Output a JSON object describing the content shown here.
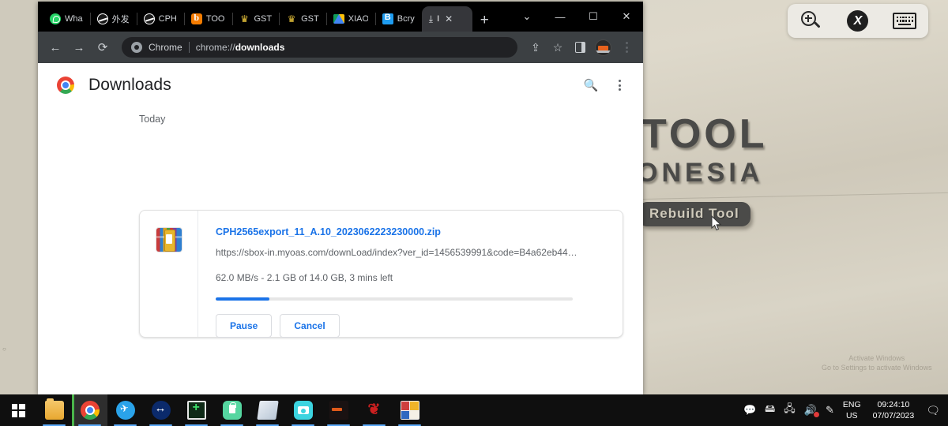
{
  "remote_toolbar": {
    "buttons": [
      {
        "name": "zoom-in",
        "icon": "magnifier-plus-icon"
      },
      {
        "name": "rustdesk",
        "icon": "rustdesk-logo-icon",
        "glyph": "X"
      },
      {
        "name": "keyboard",
        "icon": "keyboard-icon"
      }
    ]
  },
  "wallpaper": {
    "sign_line1": "TOOL",
    "sign_line2": "ONESIA",
    "sign_line3": "Rebuild Tool",
    "watermark": "Activate Windows\nGo to Settings to activate Windows"
  },
  "browser": {
    "tabs": [
      {
        "label": "Wha",
        "favicon": "whatsapp-icon",
        "active": false
      },
      {
        "label": "外发",
        "favicon": "globe-icon",
        "active": false
      },
      {
        "label": "CPH",
        "favicon": "globe-icon",
        "active": false
      },
      {
        "label": "TOO",
        "favicon": "blogger-icon",
        "active": false
      },
      {
        "label": "GST",
        "favicon": "trophy-icon",
        "active": false
      },
      {
        "label": "GST",
        "favicon": "trophy-icon",
        "active": false
      },
      {
        "label": "XIAO",
        "favicon": "google-drive-icon",
        "active": false
      },
      {
        "label": "Bcry",
        "favicon": "blue-b-icon",
        "active": false
      },
      {
        "label": "I",
        "favicon": "download-icon",
        "active": true
      }
    ],
    "new_tab_label": "+",
    "window_controls": {
      "tab_search": "⌄",
      "minimize": "—",
      "maximize": "☐",
      "close": "✕"
    },
    "toolbar": {
      "back": "←",
      "forward": "→",
      "reload": "⟳",
      "omnibox_scheme_label": "Chrome",
      "omnibox_url_prefix": "chrome://",
      "omnibox_url_bold": "downloads",
      "share_icon": "share-icon",
      "bookmark_icon": "star-icon",
      "sidepanel_icon": "side-panel-icon",
      "profile_icon": "profile-avatar",
      "menu_icon": "kebab-menu-icon"
    }
  },
  "downloads_page": {
    "title": "Downloads",
    "search_icon": "search-icon",
    "menu_icon": "kebab-menu-icon",
    "section_label": "Today",
    "item": {
      "file_icon": "winrar-archive-icon",
      "filename": "CPH2565export_11_A.10_2023062223230000.zip",
      "url": "https://sbox-in.myoas.com/downLoad/index?ver_id=1456539991&code=B4a62eb44…",
      "status": "62.0 MB/s - 2.1 GB of 14.0 GB, 3 mins left",
      "progress_percent": 15,
      "pause_label": "Pause",
      "cancel_label": "Cancel",
      "accent_color": "#1a73e8"
    }
  },
  "taskbar": {
    "start": "windows-start-icon",
    "apps": [
      {
        "name": "file-explorer",
        "icon": "folder-icon"
      },
      {
        "name": "google-chrome",
        "icon": "chrome-icon",
        "active": true
      },
      {
        "name": "telegram",
        "icon": "telegram-icon"
      },
      {
        "name": "teamviewer",
        "icon": "teamviewer-icon"
      },
      {
        "name": "green-app",
        "icon": "green-frame-icon"
      },
      {
        "name": "vpn",
        "icon": "lock-icon"
      },
      {
        "name": "notes",
        "icon": "notes-icon"
      },
      {
        "name": "camera",
        "icon": "camera-icon"
      },
      {
        "name": "dark-app",
        "icon": "dark-bar-icon"
      },
      {
        "name": "red-logo-app",
        "icon": "red-logo-icon"
      },
      {
        "name": "color-blocks-app",
        "icon": "color-blocks-icon"
      }
    ],
    "tray": {
      "chat_icon": "chat-icon",
      "usb_icon": "usb-icon",
      "network_icon": "network-icon",
      "volume_icon": "volume-muted-icon",
      "pen_icon": "pen-icon",
      "language_line1": "ENG",
      "language_line2": "US",
      "time": "09:24:10",
      "date": "07/07/2023",
      "action_center_icon": "notification-icon"
    }
  }
}
